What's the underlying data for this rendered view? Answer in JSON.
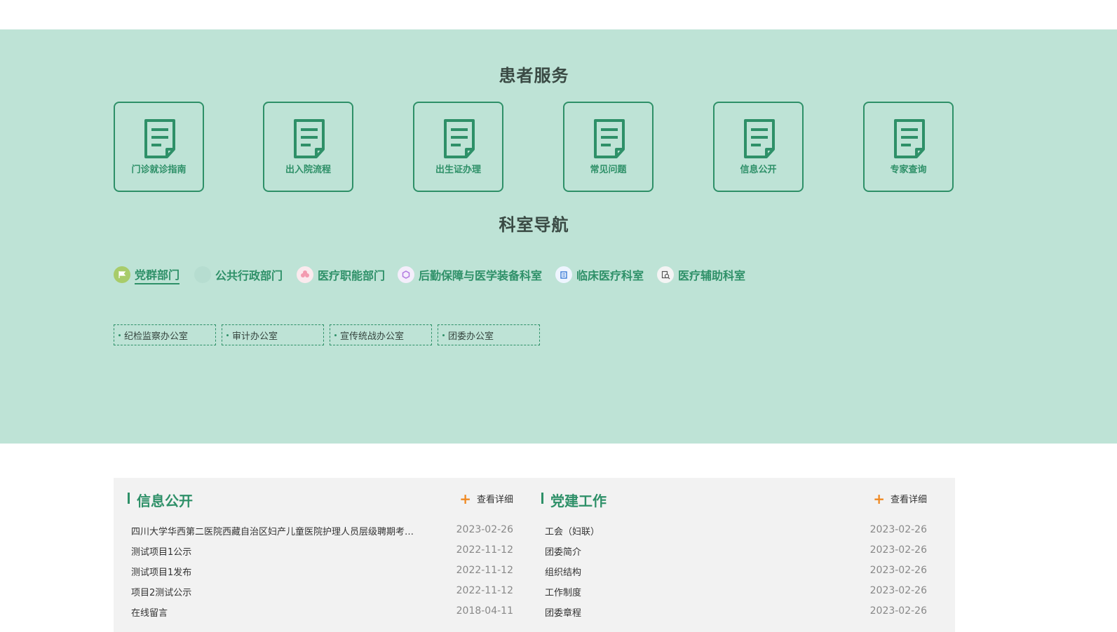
{
  "patient_services": {
    "title": "患者服务",
    "items": [
      {
        "label": "门诊就诊指南",
        "icon": "document-icon"
      },
      {
        "label": "出入院流程",
        "icon": "document-icon"
      },
      {
        "label": "出生证办理",
        "icon": "document-icon"
      },
      {
        "label": "常见问题",
        "icon": "document-icon"
      },
      {
        "label": "信息公开",
        "icon": "document-icon"
      },
      {
        "label": "专家查询",
        "icon": "document-icon"
      }
    ]
  },
  "department_nav": {
    "title": "科室导航",
    "tabs": [
      {
        "label": "党群部门",
        "icon": "flag-icon",
        "active": true
      },
      {
        "label": "公共行政部门",
        "icon": "circle-icon",
        "active": false
      },
      {
        "label": "医疗职能部门",
        "icon": "flower-icon",
        "active": false
      },
      {
        "label": "后勤保障与医学装备科室",
        "icon": "hexagon-icon",
        "active": false
      },
      {
        "label": "临床医疗科室",
        "icon": "building-icon",
        "active": false
      },
      {
        "label": "医疗辅助科室",
        "icon": "magnifier-icon",
        "active": false
      }
    ],
    "sub_items": [
      "纪检监察办公室",
      "审计办公室",
      "宣传统战办公室",
      "团委办公室"
    ]
  },
  "info_public": {
    "title": "信息公开",
    "more_label": "查看详细",
    "items": [
      {
        "title": "四川大学华西第二医院西藏自治区妇产儿童医院护理人员层级聘期考…",
        "date": "2023-02-26"
      },
      {
        "title": "测试项目1公示",
        "date": "2022-11-12"
      },
      {
        "title": "测试项目1发布",
        "date": "2022-11-12"
      },
      {
        "title": "项目2测试公示",
        "date": "2022-11-12"
      },
      {
        "title": "在线留言",
        "date": "2018-04-11"
      }
    ]
  },
  "party_work": {
    "title": "党建工作",
    "more_label": "查看详细",
    "items": [
      {
        "title": "工会（妇联）",
        "date": "2023-02-26"
      },
      {
        "title": "团委简介",
        "date": "2023-02-26"
      },
      {
        "title": "组织结构",
        "date": "2023-02-26"
      },
      {
        "title": "工作制度",
        "date": "2023-02-26"
      },
      {
        "title": "团委章程",
        "date": "2023-02-26"
      }
    ]
  },
  "colors": {
    "accent": "#2e9068",
    "band": "#bee3d6",
    "plus": "#f08a24"
  }
}
